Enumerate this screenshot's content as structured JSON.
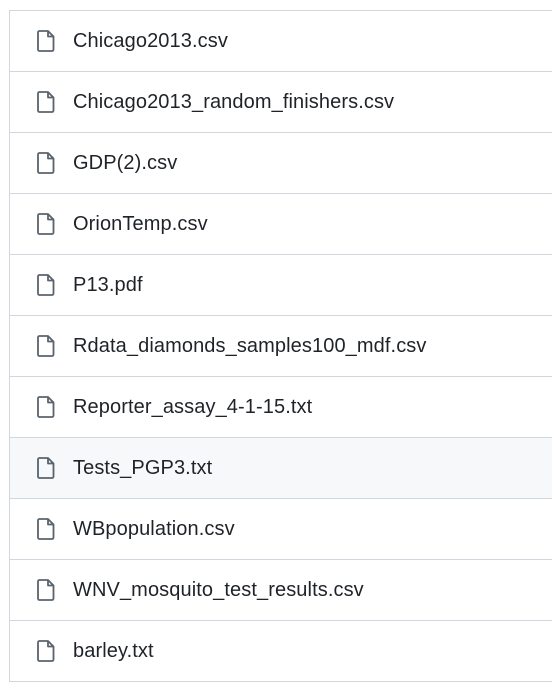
{
  "files": [
    {
      "name": "Chicago2013.csv",
      "icon": "file-icon"
    },
    {
      "name": "Chicago2013_random_finishers.csv",
      "icon": "file-icon"
    },
    {
      "name": "GDP(2).csv",
      "icon": "file-icon"
    },
    {
      "name": "OrionTemp.csv",
      "icon": "file-icon"
    },
    {
      "name": "P13.pdf",
      "icon": "file-icon"
    },
    {
      "name": "Rdata_diamonds_samples100_mdf.csv",
      "icon": "file-icon"
    },
    {
      "name": "Reporter_assay_4-1-15.txt",
      "icon": "file-icon"
    },
    {
      "name": "Tests_PGP3.txt",
      "icon": "file-icon",
      "hovered": true
    },
    {
      "name": "WBpopulation.csv",
      "icon": "file-icon"
    },
    {
      "name": "WNV_mosquito_test_results.csv",
      "icon": "file-icon"
    },
    {
      "name": "barley.txt",
      "icon": "file-icon"
    }
  ],
  "colors": {
    "text": "#1f2328",
    "icon": "#59636e",
    "border": "#d0d7de",
    "hover_bg": "#f6f8fa"
  }
}
